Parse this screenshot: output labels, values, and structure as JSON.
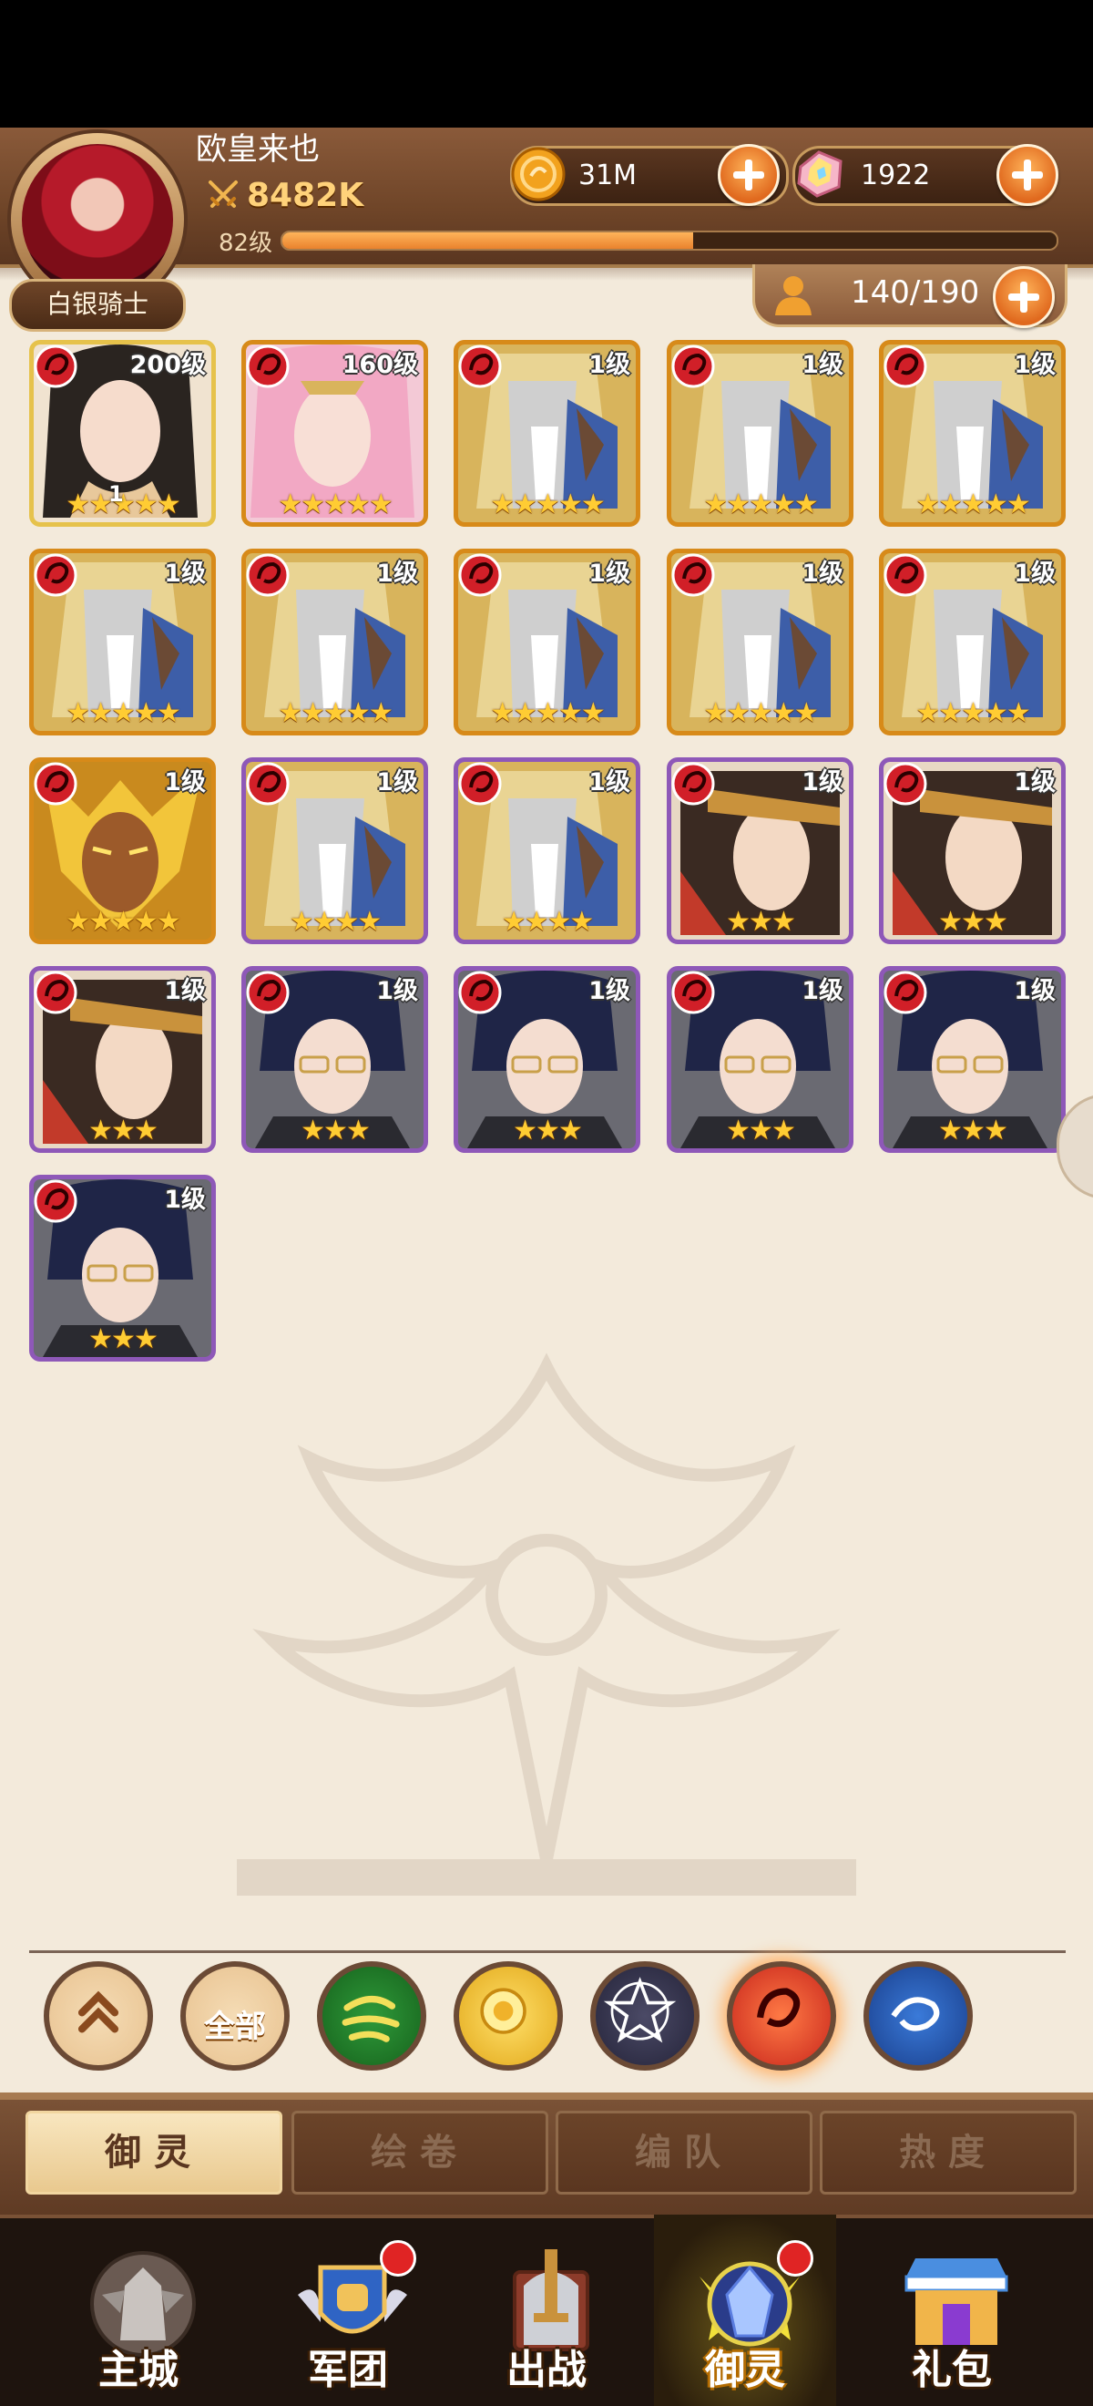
{
  "player": {
    "name": "欧皇来也",
    "power": "8482K",
    "level_label": "82级",
    "exp_fraction": 0.53,
    "rank": "白银骑士"
  },
  "currencies": {
    "gold": "31M",
    "gems": "1922"
  },
  "capacity": "140/190",
  "heroes": [
    {
      "level": "200级",
      "stars": 5,
      "frame": "gold-lite",
      "portrait": "dark-hair-woman",
      "badge": "1"
    },
    {
      "level": "160级",
      "stars": 5,
      "frame": "gold",
      "portrait": "pink-hair-man"
    },
    {
      "level": "1级",
      "stars": 5,
      "frame": "gold",
      "portrait": "white-armor"
    },
    {
      "level": "1级",
      "stars": 5,
      "frame": "gold",
      "portrait": "white-armor"
    },
    {
      "level": "1级",
      "stars": 5,
      "frame": "gold",
      "portrait": "white-armor"
    },
    {
      "level": "1级",
      "stars": 5,
      "frame": "gold",
      "portrait": "white-armor"
    },
    {
      "level": "1级",
      "stars": 5,
      "frame": "gold",
      "portrait": "white-armor"
    },
    {
      "level": "1级",
      "stars": 5,
      "frame": "gold",
      "portrait": "white-armor"
    },
    {
      "level": "1级",
      "stars": 5,
      "frame": "gold",
      "portrait": "white-armor"
    },
    {
      "level": "1级",
      "stars": 5,
      "frame": "gold",
      "portrait": "white-armor"
    },
    {
      "level": "1级",
      "stars": 5,
      "frame": "gold",
      "portrait": "golden-warrior"
    },
    {
      "level": "1级",
      "stars": 4,
      "frame": "purple",
      "portrait": "white-armor"
    },
    {
      "level": "1级",
      "stars": 4,
      "frame": "purple",
      "portrait": "white-armor"
    },
    {
      "level": "1级",
      "stars": 3,
      "frame": "purple",
      "portrait": "dark-hair-headband"
    },
    {
      "level": "1级",
      "stars": 3,
      "frame": "purple",
      "portrait": "dark-hair-headband"
    },
    {
      "level": "1级",
      "stars": 3,
      "frame": "purple",
      "portrait": "dark-hair-headband"
    },
    {
      "level": "1级",
      "stars": 3,
      "frame": "purple",
      "portrait": "glasses-man"
    },
    {
      "level": "1级",
      "stars": 3,
      "frame": "purple",
      "portrait": "glasses-man"
    },
    {
      "level": "1级",
      "stars": 3,
      "frame": "purple",
      "portrait": "glasses-man"
    },
    {
      "level": "1级",
      "stars": 3,
      "frame": "purple",
      "portrait": "glasses-man"
    },
    {
      "level": "1级",
      "stars": 3,
      "frame": "purple",
      "portrait": "glasses-man"
    }
  ],
  "filters": [
    {
      "name": "collapse",
      "text": "",
      "icon": "double-chevron-up-icon"
    },
    {
      "name": "all",
      "text": "全部",
      "icon": ""
    },
    {
      "name": "wind",
      "text": "",
      "icon": "wind-element-icon"
    },
    {
      "name": "light",
      "text": "",
      "icon": "rose-element-icon"
    },
    {
      "name": "dark",
      "text": "",
      "icon": "star-element-icon"
    },
    {
      "name": "fire",
      "text": "",
      "icon": "fire-element-icon",
      "selected": true
    },
    {
      "name": "water",
      "text": "",
      "icon": "water-element-icon"
    }
  ],
  "tabs": [
    "御灵",
    "绘卷",
    "编队",
    "热度"
  ],
  "nav": [
    "主城",
    "军团",
    "出战",
    "御灵",
    "礼包"
  ],
  "colors": {
    "gold_frame": "#d78a19",
    "purple_frame": "#8e58b8",
    "accent_orange": "#e9822d"
  }
}
